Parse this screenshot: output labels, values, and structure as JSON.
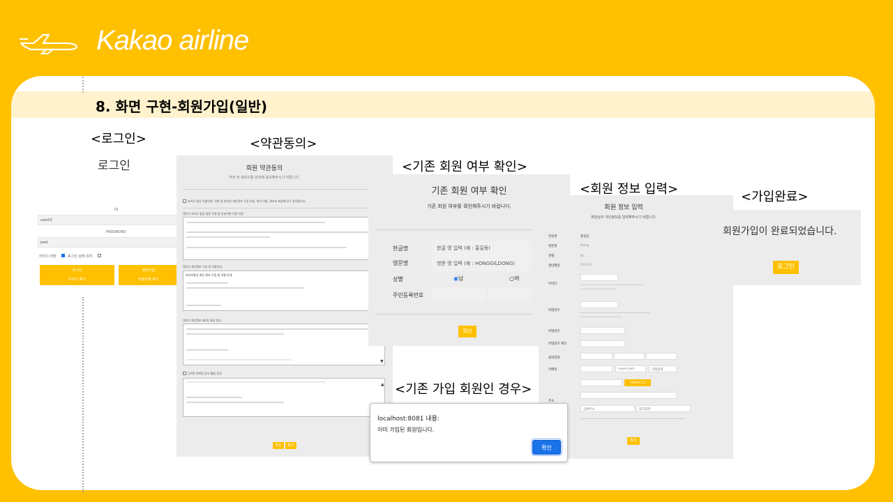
{
  "header": {
    "brand": "Kakao airline",
    "plane_icon": "airplane-icon"
  },
  "slide": {
    "title": "8. 화면 구현-회원가입(일반)"
  },
  "sections": {
    "login": "<로그인>",
    "terms": "<약관동의>",
    "existing_check": "<기존 회원 여부 확인>",
    "member_info": "<회원 정보 입력>",
    "complete": "<가입완료>",
    "already_member": "<기존 가입 회원인 경우>"
  },
  "login": {
    "title": "로그인",
    "id_label": "ID",
    "id_value": "user01",
    "pw_label": "PASSWORD",
    "pw_value": "pwd",
    "remember_id": "아이디 저장",
    "keep_login": "로그인 상태 유지",
    "login_button": "로그인",
    "join_button": "회원가입",
    "find_id": "아이디 찾기",
    "find_pw": "비밀번호 찾기"
  },
  "terms": {
    "title": "회원 약관동의",
    "subtitle": "약관 및 정보이용 안내에 동의해주시기 바랍니다.",
    "agree_all": "카카오 항공 이용약관, 약관 및 본인의 개인정보 수집·이용, 위치 이용, 개코처 회원에 모두 동의합니다.",
    "section1": "[필수] 카카오 항공 일반 규정 및 운송약관 이용 약관",
    "section2": "[필수] 개인정보 수집 및 이용안내",
    "section3": "[필수] 개인정보 제3자 제공 동의",
    "section4": "[선택] 마케팅 광고 활용 동의",
    "item_text": "카카오항공 개인 정보 수집 및 이용 안내",
    "cancel_button": "취소",
    "agree_button": "동의"
  },
  "existing": {
    "title": "기존 회원 여부 확인",
    "subtitle": "기존 회원 여부를 확인해주시기 바랍니다.",
    "korean_name_label": "한글명",
    "korean_name_placeholder": "한글 명 입력 (예 : 홍길동)",
    "english_name_label": "영문명",
    "english_name_placeholder": "영문 명 입력 (예 : HONGGILDONG)",
    "gender_label": "성별",
    "gender_male": "남",
    "gender_female": "여",
    "rrn_label": "주민등록번호",
    "confirm_button": "확인"
  },
  "member": {
    "title": "회원 정보 입력",
    "subtitle": "회원님의 개인정보를 입력해주시기 바랍니다.",
    "fields": {
      "korean_name": "한글명",
      "english_name": "영문명",
      "gender": "성별",
      "birth": "생년월일",
      "id": "아이디",
      "password": "비밀번호",
      "password_confirm": "비밀번호 확인",
      "phone": "휴대전화",
      "email": "이메일",
      "address": "주소"
    },
    "values": {
      "korean_name": "홍길동",
      "english_name": "Hong",
      "gender": "남",
      "birth": "990101",
      "email_domain": "naver.com",
      "email_direct": "직접입력",
      "zip_button": "우편번호 찾기",
      "detail_address": "상세주소",
      "ref_item": "참고항목"
    },
    "confirm_button": "확인"
  },
  "complete": {
    "message": "회원가입이 완료되었습니다.",
    "login_button": "로그인"
  },
  "dialog": {
    "host": "localhost:8081 내용:",
    "message": "이미 가입된 회원입니다.",
    "ok": "확인"
  },
  "colors": {
    "accent": "#FFC000",
    "title_band": "#FFF2CC",
    "dialog_button": "#1A73E8"
  }
}
